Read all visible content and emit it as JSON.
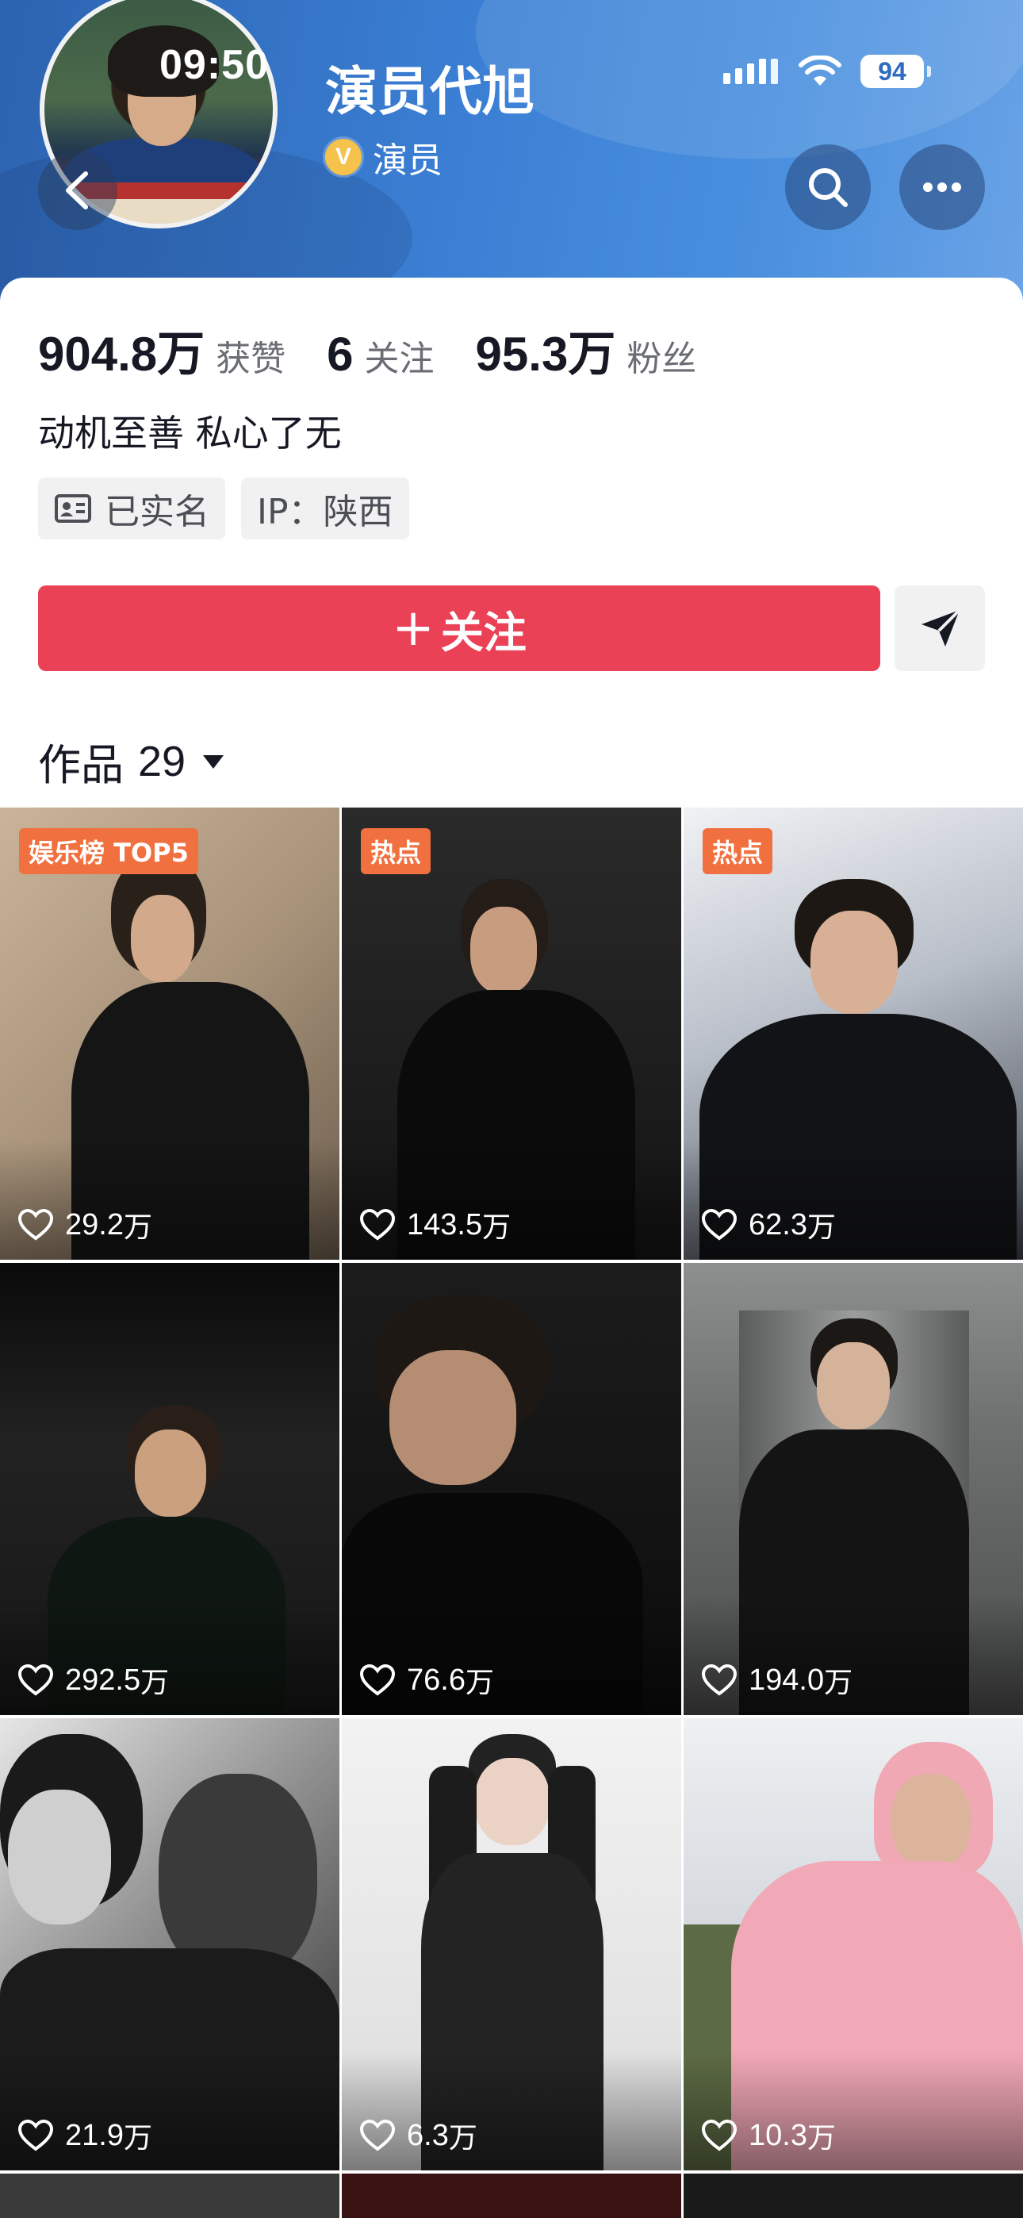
{
  "status_bar": {
    "time": "09:50",
    "battery": "94"
  },
  "profile": {
    "name": "演员代旭",
    "verified_badge": "V",
    "verified_label": "演员",
    "stats": [
      {
        "value": "904.8万",
        "label": "获赞"
      },
      {
        "value": "6",
        "label": "关注"
      },
      {
        "value": "95.3万",
        "label": "粉丝"
      }
    ],
    "bio": "动机至善 私心了无",
    "tags": {
      "real_name": "已实名",
      "ip": "IP：陕西"
    }
  },
  "actions": {
    "follow_plus": "+",
    "follow_label": "关注"
  },
  "works_tab": {
    "label": "作品",
    "count": "29"
  },
  "videos": [
    {
      "badge": "娱乐榜 TOP5",
      "likes": "29.2",
      "unit": "万"
    },
    {
      "badge": "热点",
      "likes": "143.5",
      "unit": "万"
    },
    {
      "badge": "热点",
      "likes": "62.3",
      "unit": "万"
    },
    {
      "badge": "",
      "likes": "292.5",
      "unit": "万"
    },
    {
      "badge": "",
      "likes": "76.6",
      "unit": "万"
    },
    {
      "badge": "",
      "likes": "194.0",
      "unit": "万"
    },
    {
      "badge": "",
      "likes": "21.9",
      "unit": "万"
    },
    {
      "badge": "",
      "likes": "6.3",
      "unit": "万"
    },
    {
      "badge": "",
      "likes": "10.3",
      "unit": "万"
    }
  ],
  "colors": {
    "follow": "#ea4156",
    "badge": "#f0703f",
    "header": "#3b7fd4"
  },
  "icons": [
    "back-icon",
    "search-icon",
    "more-icon",
    "signal-icon",
    "wifi-icon",
    "battery-icon",
    "id-card-icon",
    "share-icon",
    "caret-down-icon",
    "heart-icon"
  ]
}
